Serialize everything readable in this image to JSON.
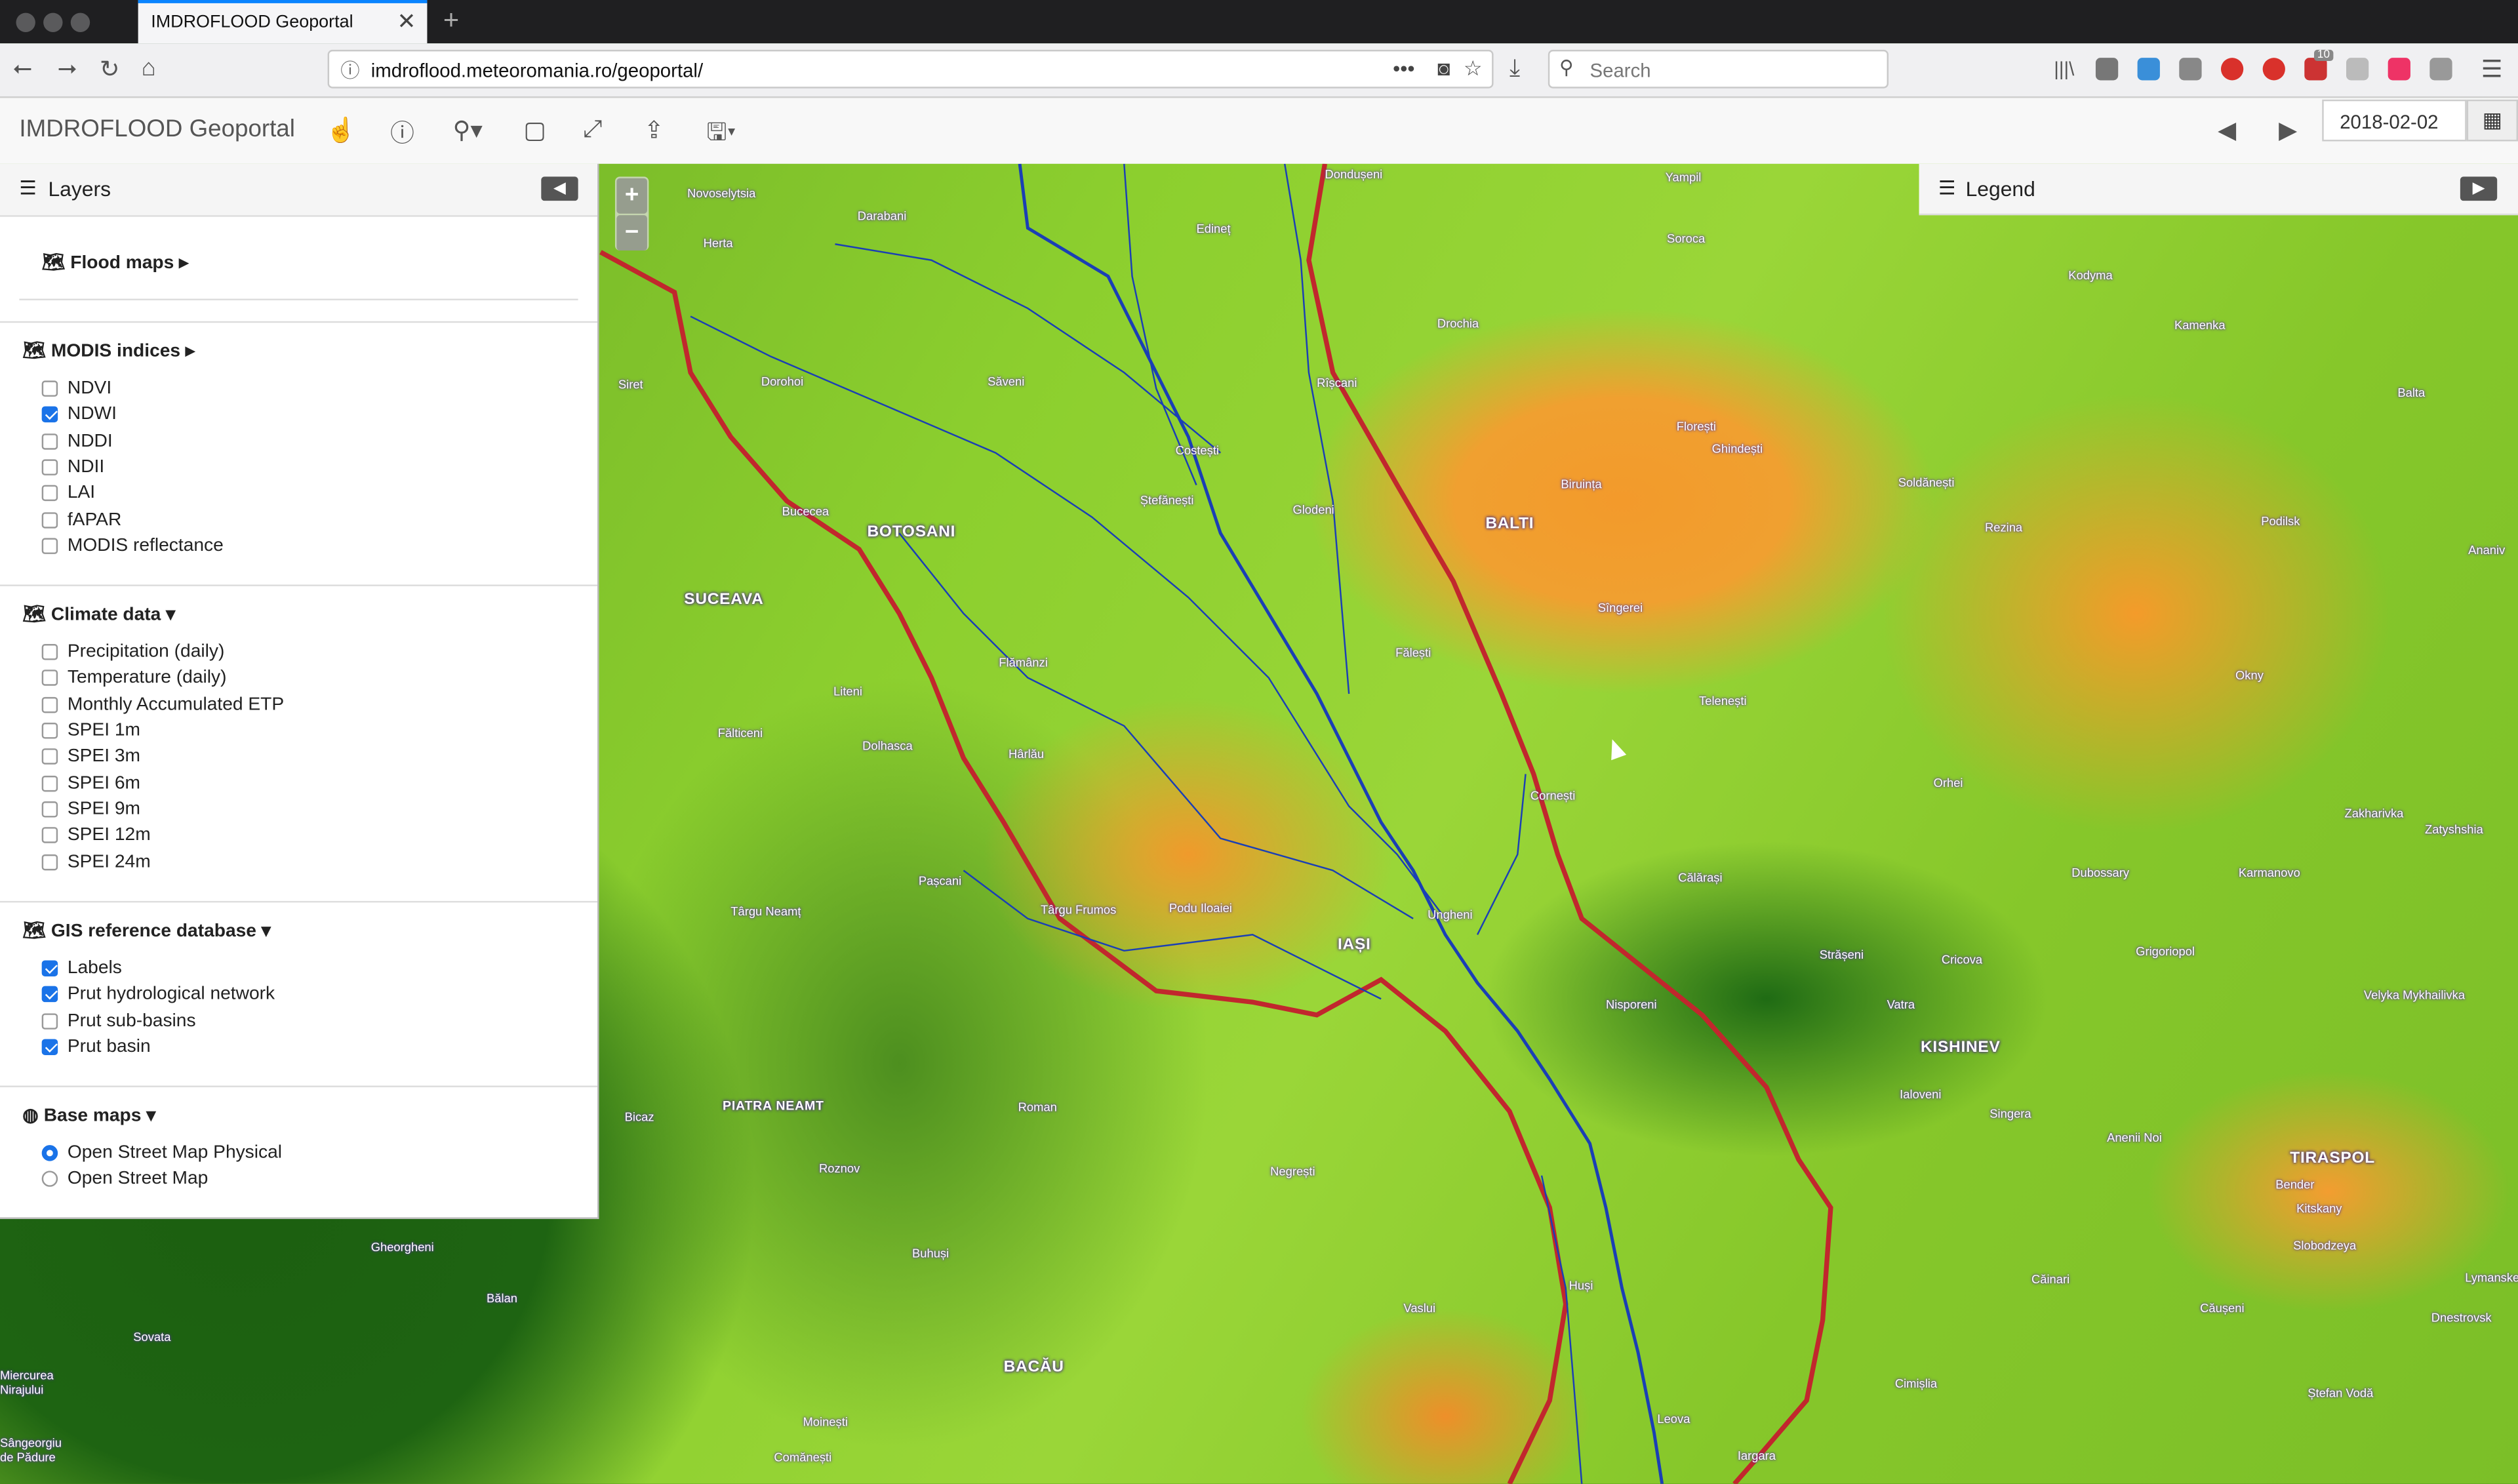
{
  "browser": {
    "tab_title": "IMDROFLOOD Geoportal",
    "url": "imdroflood.meteoromania.ro/geoportal/",
    "search_placeholder": "Search",
    "badge_count": "10"
  },
  "app": {
    "brand": "IMDROFLOOD Geoportal",
    "date_value": "2018-02-02"
  },
  "sidebar": {
    "title": "Layers",
    "sections": {
      "flood": {
        "title": "Flood maps"
      },
      "modis": {
        "title": "MODIS indices",
        "items": [
          {
            "label": "NDVI",
            "checked": false
          },
          {
            "label": "NDWI",
            "checked": true
          },
          {
            "label": "NDDI",
            "checked": false
          },
          {
            "label": "NDII",
            "checked": false
          },
          {
            "label": "LAI",
            "checked": false
          },
          {
            "label": "fAPAR",
            "checked": false
          },
          {
            "label": "MODIS reflectance",
            "checked": false
          }
        ]
      },
      "climate": {
        "title": "Climate data",
        "items": [
          {
            "label": "Precipitation (daily)",
            "checked": false
          },
          {
            "label": "Temperature (daily)",
            "checked": false
          },
          {
            "label": "Monthly Accumulated ETP",
            "checked": false
          },
          {
            "label": "SPEI 1m",
            "checked": false
          },
          {
            "label": "SPEI 3m",
            "checked": false
          },
          {
            "label": "SPEI 6m",
            "checked": false
          },
          {
            "label": "SPEI 9m",
            "checked": false
          },
          {
            "label": "SPEI 12m",
            "checked": false
          },
          {
            "label": "SPEI 24m",
            "checked": false
          }
        ]
      },
      "gis": {
        "title": "GIS reference database",
        "items": [
          {
            "label": "Labels",
            "checked": true
          },
          {
            "label": "Prut hydrological network",
            "checked": true
          },
          {
            "label": "Prut sub-basins",
            "checked": false
          },
          {
            "label": "Prut basin",
            "checked": true
          }
        ]
      },
      "base": {
        "title": "Base maps",
        "items": [
          {
            "label": "Open Street Map Physical",
            "selected": true
          },
          {
            "label": "Open Street Map",
            "selected": false
          }
        ]
      }
    }
  },
  "legend": {
    "title": "Legend"
  },
  "map": {
    "zoom_in": "+",
    "zoom_out": "−",
    "cities": [
      "BOTOSANI",
      "BALTI",
      "SUCEAVA",
      "IAȘI",
      "KISHINEV",
      "TIRASPOL",
      "PIATRA NEAMT",
      "BACĂU"
    ],
    "places": [
      "Dondușeni",
      "Yampil",
      "Novoselytsia",
      "Darabani",
      "Herta",
      "Edineț",
      "Soroca",
      "Kodyma",
      "Drochia",
      "Kamenka",
      "Balta",
      "Siret",
      "Dorohoi",
      "Săveni",
      "Rîșcani",
      "Florești",
      "Ghindești",
      "Costești",
      "Ștefănești",
      "Glodeni",
      "Bucecea",
      "Biruința",
      "Soldănești",
      "Rezina",
      "Podilsk",
      "Ananiv",
      "Sîngerei",
      "Fălești",
      "Telenești",
      "Okny",
      "Flămânzi",
      "Liteni",
      "Fălticeni",
      "Dolhasca",
      "Hârlău",
      "Cornești",
      "Orhei",
      "Zakharivka",
      "Zatyshshia",
      "Călărași",
      "Dubossary",
      "Karmanovo",
      "Pașcani",
      "Târgu Neamț",
      "Târgu Frumos",
      "Podu Iloaiei",
      "Ungheni",
      "Grigoriopol",
      "Strășeni",
      "Cricova",
      "Vatra",
      "Velyka Mykhailivka",
      "Nisporeni",
      "Ialoveni",
      "Singera",
      "Anenii Noi",
      "Roman",
      "Bender",
      "Bicaz",
      "Roznov",
      "Negrești",
      "Kitskany",
      "Slobodzeya",
      "Gheorgheni",
      "Buhuși",
      "Huși",
      "Vaslui",
      "Căinari",
      "Căușeni",
      "Bălan",
      "Sovata",
      "Lymanske",
      "Miercurea Nirajului",
      "Dnestrovsk",
      "Cimișlia",
      "Ștefan Vodă",
      "Moinești",
      "Leova",
      "Sângeorgiu de Pădure",
      "Comănești",
      "Iargara"
    ]
  }
}
